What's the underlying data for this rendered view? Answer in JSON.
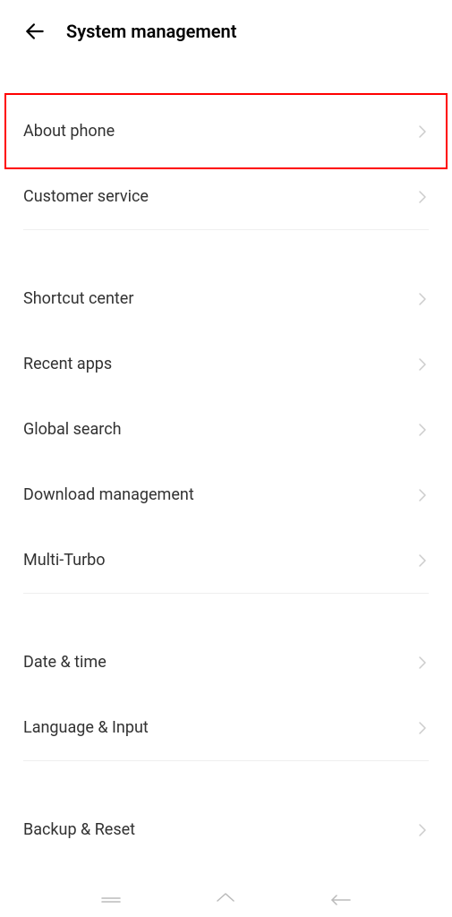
{
  "header": {
    "title": "System management"
  },
  "sections": [
    {
      "items": [
        {
          "label": "About phone",
          "highlighted": true
        },
        {
          "label": "Customer service",
          "highlighted": false
        }
      ]
    },
    {
      "items": [
        {
          "label": "Shortcut center",
          "highlighted": false
        },
        {
          "label": "Recent apps",
          "highlighted": false
        },
        {
          "label": "Global search",
          "highlighted": false
        },
        {
          "label": "Download management",
          "highlighted": false
        },
        {
          "label": "Multi-Turbo",
          "highlighted": false
        }
      ]
    },
    {
      "items": [
        {
          "label": "Date & time",
          "highlighted": false
        },
        {
          "label": "Language & Input",
          "highlighted": false
        }
      ]
    },
    {
      "items": [
        {
          "label": "Backup & Reset",
          "highlighted": false
        }
      ]
    }
  ]
}
